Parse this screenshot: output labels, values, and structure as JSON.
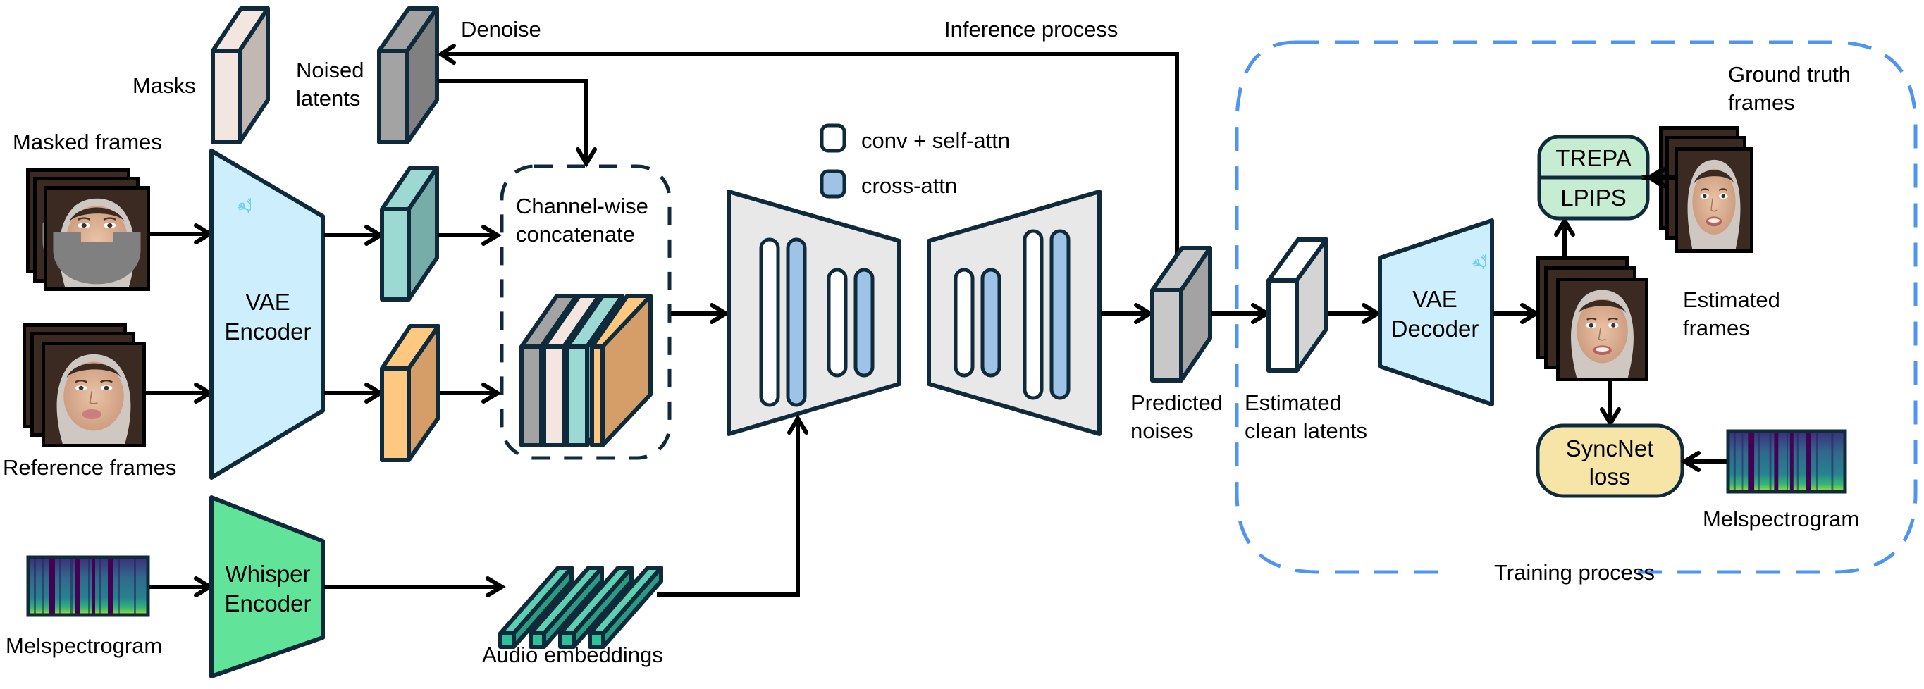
{
  "labels": {
    "masks": "Masks",
    "noised_latents_1": "Noised",
    "noised_latents_2": "latents",
    "denoise": "Denoise",
    "inference_process": "Inference process",
    "masked_frames": "Masked frames",
    "reference_frames": "Reference frames",
    "melspectrogram_left": "Melspectrogram",
    "vae_encoder_1": "VAE",
    "vae_encoder_2": "Encoder",
    "whisper_encoder_1": "Whisper",
    "whisper_encoder_2": "Encoder",
    "channel_wise_1": "Channel-wise",
    "channel_wise_2": "concatenate",
    "audio_embeddings": "Audio embeddings",
    "predicted_noises_1": "Predicted",
    "predicted_noises_2": "noises",
    "estimated_clean_1": "Estimated",
    "estimated_clean_2": "clean latents",
    "vae_decoder_1": "VAE",
    "vae_decoder_2": "Decoder",
    "estimated_frames_1": "Estimated",
    "estimated_frames_2": "frames",
    "ground_truth_1": "Ground truth",
    "ground_truth_2": "frames",
    "trepa": "TREPA",
    "lpips": "LPIPS",
    "syncnet_1": "SyncNet",
    "syncnet_2": "loss",
    "melspectrogram_right": "Melspectrogram",
    "training_process": "Training process"
  },
  "legend": [
    {
      "label": "conv + self-attn",
      "color": "#ffffff"
    },
    {
      "label": "cross-attn",
      "color": "#9fc3e7"
    }
  ],
  "colors": {
    "vae": "#cdeefc",
    "whisper": "#62e39a",
    "unet": "#e8e8e8",
    "cross_attn": "#9fc3e7",
    "mask_front": "#c1b7b3",
    "mask_side": "#f3e6e0",
    "noise_front": "#808080",
    "noise_side": "#a3a3a3",
    "teal_front": "#77ada8",
    "teal_side": "#9dd9d3",
    "orange_front": "#d59e68",
    "orange_side": "#ffc880",
    "pred_front": "#a3a3a3",
    "pred_side": "#c8c8c8",
    "clean_front": "#d4d4d4",
    "clean_side": "#ffffff",
    "trepa_box": "#c6ecd1",
    "syncnet_box": "#f6e5a6",
    "training_border": "#4f94ef",
    "snowflake": "#6fcdf2",
    "outline": "#0f2a3a",
    "embed_front": "#2fbf9a",
    "embed_side": "#2a9a80",
    "embed_top": "#5ecfb0"
  },
  "icons": {
    "snowflake": "snowflake-icon",
    "face": "face-thumbnail",
    "spectrogram": "spectrogram-image"
  }
}
